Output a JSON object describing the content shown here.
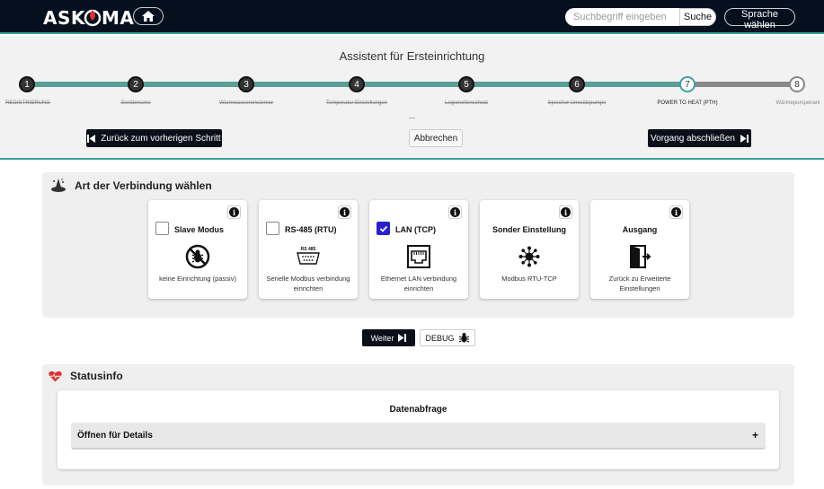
{
  "header": {
    "brand": "ASKOMA",
    "search_placeholder": "Suchbegriff eingeben",
    "search_button": "Suche",
    "language_button": "Sprache wählen"
  },
  "wizard": {
    "title": "Assistent für Ersteinrichtung",
    "steps": [
      {
        "number": "1",
        "label": "REGISTRIERUNG",
        "state": "done"
      },
      {
        "number": "2",
        "label": "Gerätename",
        "state": "done"
      },
      {
        "number": "3",
        "label": "Warmwassererwärmer",
        "state": "done"
      },
      {
        "number": "4",
        "label": "Temperatur Einstellungen",
        "state": "done"
      },
      {
        "number": "5",
        "label": "Legionellenschutz",
        "state": "done"
      },
      {
        "number": "6",
        "label": "Speicher Umwälzpumpe",
        "state": "done"
      },
      {
        "number": "7",
        "label": "POWER TO HEAT (PTH)",
        "state": "current"
      },
      {
        "number": "8",
        "label": "Wärmepumpenanl",
        "state": "future"
      }
    ],
    "dots": "...",
    "back_button": "Zurück zum vorherigen Schritt",
    "cancel_button": "Abbrechen",
    "finish_button": "Vorgang abschließen"
  },
  "connection": {
    "title": "Art der Verbindung wählen",
    "cards": [
      {
        "title": "Slave Modus",
        "description": "keine Einrichtung (passiv)",
        "checked": false,
        "icon": "no-bug-icon"
      },
      {
        "title": "RS-485 (RTU)",
        "description": "Serielle Modbus verbindung einrichten",
        "checked": false,
        "icon": "serial-port-icon",
        "icon_caption": "RS 485"
      },
      {
        "title": "LAN (TCP)",
        "description": "Ethernet LAN verbindung einrichten",
        "checked": true,
        "icon": "ethernet-port-icon"
      },
      {
        "title": "Sonder Einstellung",
        "description": "Modbus RTU-TCP",
        "icon": "network-hub-icon"
      },
      {
        "title": "Ausgang",
        "description": "Zurück zu Erweiterte Einstellungen",
        "icon": "exit-door-icon"
      }
    ],
    "info_glyph": "i",
    "next_button": "Weiter",
    "debug_button": "DEBUG"
  },
  "status": {
    "title": "Statusinfo",
    "card_heading": "Datenabfrage",
    "accordion_label": "Öffnen für Details",
    "accordion_toggle": "+"
  },
  "colors": {
    "header_bg": "#05101f",
    "accent_teal": "#3aa39a",
    "track_done": "#5a9e98",
    "checkbox_checked": "#2b1fd0",
    "heart_red": "#e0312f"
  }
}
